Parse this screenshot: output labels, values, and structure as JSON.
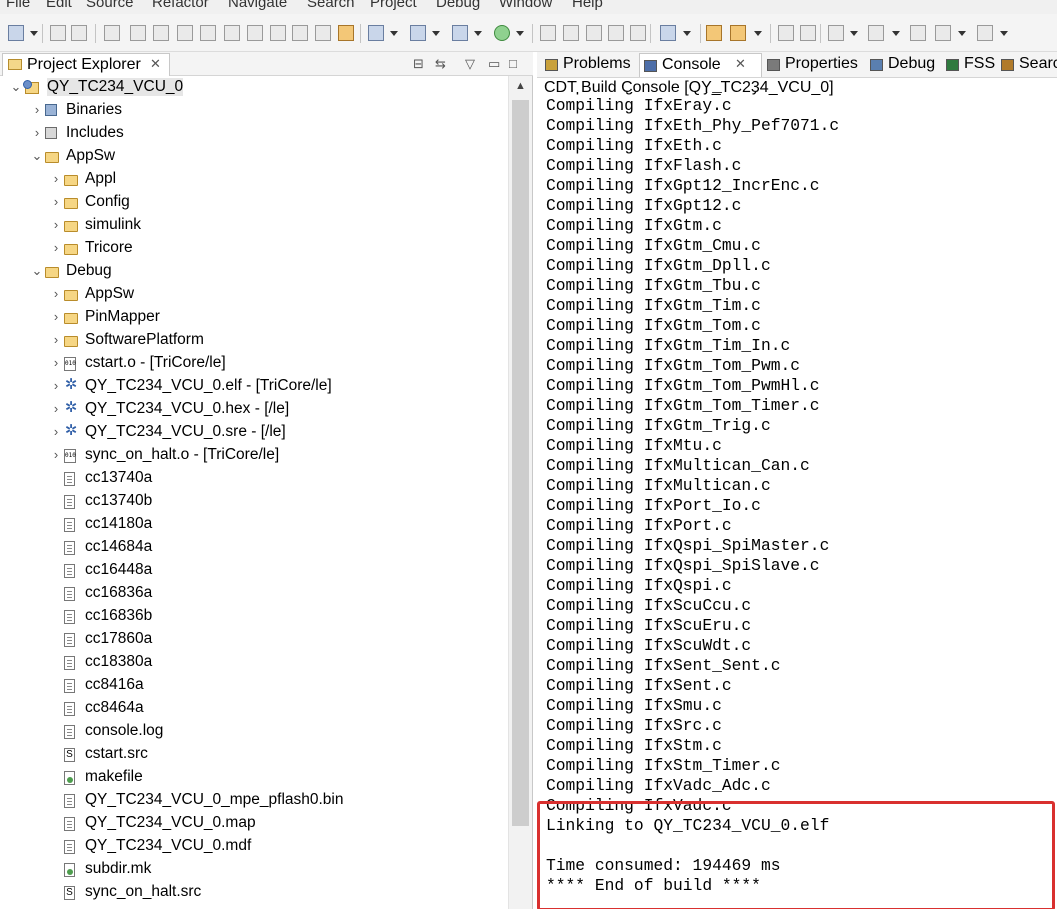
{
  "menu": [
    "File",
    "Edit",
    "Source",
    "Refactor",
    "Navigate",
    "Search",
    "Project",
    "Debug",
    "Window",
    "Help"
  ],
  "project_explorer": {
    "tab_label": "Project Explorer",
    "tab_close": "✕",
    "view_buttons": [
      "collapse-all",
      "link-with-editor",
      "view-menu",
      "minimize",
      "maximize"
    ],
    "tree": [
      {
        "label": "QY_TC234_VCU_0",
        "icon": "project-icon",
        "depth": 0,
        "expander": "expanded",
        "selected": true
      },
      {
        "label": "Binaries",
        "icon": "binaries-icon",
        "depth": 1,
        "expander": "collapsed"
      },
      {
        "label": "Includes",
        "icon": "includes-icon",
        "depth": 1,
        "expander": "collapsed"
      },
      {
        "label": "AppSw",
        "icon": "folder-icon",
        "depth": 1,
        "expander": "expanded"
      },
      {
        "label": "Appl",
        "icon": "folder-icon",
        "depth": 2,
        "expander": "collapsed"
      },
      {
        "label": "Config",
        "icon": "folder-icon",
        "depth": 2,
        "expander": "collapsed"
      },
      {
        "label": "simulink",
        "icon": "folder-icon",
        "depth": 2,
        "expander": "collapsed"
      },
      {
        "label": "Tricore",
        "icon": "folder-icon",
        "depth": 2,
        "expander": "collapsed"
      },
      {
        "label": "Debug",
        "icon": "folder-icon",
        "depth": 1,
        "expander": "expanded"
      },
      {
        "label": "AppSw",
        "icon": "folder-icon",
        "depth": 2,
        "expander": "collapsed"
      },
      {
        "label": "PinMapper",
        "icon": "folder-icon",
        "depth": 2,
        "expander": "collapsed"
      },
      {
        "label": "SoftwarePlatform",
        "icon": "folder-icon",
        "depth": 2,
        "expander": "collapsed"
      },
      {
        "label": "cstart.o - [TriCore/le]",
        "icon": "object-file-icon",
        "depth": 2,
        "expander": "collapsed"
      },
      {
        "label": "QY_TC234_VCU_0.elf - [TriCore/le]",
        "icon": "binary-gear-icon",
        "depth": 2,
        "expander": "collapsed"
      },
      {
        "label": "QY_TC234_VCU_0.hex - [/le]",
        "icon": "binary-gear-icon",
        "depth": 2,
        "expander": "collapsed"
      },
      {
        "label": "QY_TC234_VCU_0.sre - [/le]",
        "icon": "binary-gear-icon",
        "depth": 2,
        "expander": "collapsed"
      },
      {
        "label": "sync_on_halt.o - [TriCore/le]",
        "icon": "object-file-icon",
        "depth": 2,
        "expander": "collapsed"
      },
      {
        "label": "cc13740a",
        "icon": "file-icon",
        "depth": 2,
        "expander": "none"
      },
      {
        "label": "cc13740b",
        "icon": "file-icon",
        "depth": 2,
        "expander": "none"
      },
      {
        "label": "cc14180a",
        "icon": "file-icon",
        "depth": 2,
        "expander": "none"
      },
      {
        "label": "cc14684a",
        "icon": "file-icon",
        "depth": 2,
        "expander": "none"
      },
      {
        "label": "cc16448a",
        "icon": "file-icon",
        "depth": 2,
        "expander": "none"
      },
      {
        "label": "cc16836a",
        "icon": "file-icon",
        "depth": 2,
        "expander": "none"
      },
      {
        "label": "cc16836b",
        "icon": "file-icon",
        "depth": 2,
        "expander": "none"
      },
      {
        "label": "cc17860a",
        "icon": "file-icon",
        "depth": 2,
        "expander": "none"
      },
      {
        "label": "cc18380a",
        "icon": "file-icon",
        "depth": 2,
        "expander": "none"
      },
      {
        "label": "cc8416a",
        "icon": "file-icon",
        "depth": 2,
        "expander": "none"
      },
      {
        "label": "cc8464a",
        "icon": "file-icon",
        "depth": 2,
        "expander": "none"
      },
      {
        "label": "console.log",
        "icon": "file-icon",
        "depth": 2,
        "expander": "none"
      },
      {
        "label": "cstart.src",
        "icon": "source-file-icon",
        "depth": 2,
        "expander": "none"
      },
      {
        "label": "makefile",
        "icon": "makefile-icon",
        "depth": 2,
        "expander": "none"
      },
      {
        "label": "QY_TC234_VCU_0_mpe_pflash0.bin",
        "icon": "file-icon",
        "depth": 2,
        "expander": "none"
      },
      {
        "label": "QY_TC234_VCU_0.map",
        "icon": "file-icon",
        "depth": 2,
        "expander": "none"
      },
      {
        "label": "QY_TC234_VCU_0.mdf",
        "icon": "file-icon",
        "depth": 2,
        "expander": "none"
      },
      {
        "label": "subdir.mk",
        "icon": "makefile-icon",
        "depth": 2,
        "expander": "none"
      },
      {
        "label": "sync_on_halt.src",
        "icon": "source-file-icon",
        "depth": 2,
        "expander": "none"
      }
    ]
  },
  "right_tabs": [
    {
      "label": "Problems",
      "icon": "problems-icon",
      "active": false
    },
    {
      "label": "Console",
      "icon": "console-icon",
      "active": true,
      "close": "✕"
    },
    {
      "label": "Properties",
      "icon": "properties-icon",
      "active": false
    },
    {
      "label": "Debug",
      "icon": "debug-icon",
      "active": false
    },
    {
      "label": "FSS",
      "icon": "fss-icon",
      "active": false
    },
    {
      "label": "Search",
      "icon": "search-icon",
      "active": false
    }
  ],
  "console": {
    "title": "CDT Build Console [QY_TC234_VCU_0]",
    "partial_top_line": "Compiling IfxEray_Eray.c",
    "lines": [
      "Compiling IfxEray.c",
      "Compiling IfxEth_Phy_Pef7071.c",
      "Compiling IfxEth.c",
      "Compiling IfxFlash.c",
      "Compiling IfxGpt12_IncrEnc.c",
      "Compiling IfxGpt12.c",
      "Compiling IfxGtm.c",
      "Compiling IfxGtm_Cmu.c",
      "Compiling IfxGtm_Dpll.c",
      "Compiling IfxGtm_Tbu.c",
      "Compiling IfxGtm_Tim.c",
      "Compiling IfxGtm_Tom.c",
      "Compiling IfxGtm_Tim_In.c",
      "Compiling IfxGtm_Tom_Pwm.c",
      "Compiling IfxGtm_Tom_PwmHl.c",
      "Compiling IfxGtm_Tom_Timer.c",
      "Compiling IfxGtm_Trig.c",
      "Compiling IfxMtu.c",
      "Compiling IfxMultican_Can.c",
      "Compiling IfxMultican.c",
      "Compiling IfxPort_Io.c",
      "Compiling IfxPort.c",
      "Compiling IfxQspi_SpiMaster.c",
      "Compiling IfxQspi_SpiSlave.c",
      "Compiling IfxQspi.c",
      "Compiling IfxScuCcu.c",
      "Compiling IfxScuEru.c",
      "Compiling IfxScuWdt.c",
      "Compiling IfxSent_Sent.c",
      "Compiling IfxSent.c",
      "Compiling IfxSmu.c",
      "Compiling IfxSrc.c",
      "Compiling IfxStm.c",
      "Compiling IfxStm_Timer.c",
      "Compiling IfxVadc_Adc.c",
      "Compiling IfxVadc.c",
      "Linking to QY_TC234_VCU_0.elf",
      "",
      "Time consumed: 194469 ms",
      "**** End of build ****"
    ],
    "highlight_color": "#d9302f"
  }
}
